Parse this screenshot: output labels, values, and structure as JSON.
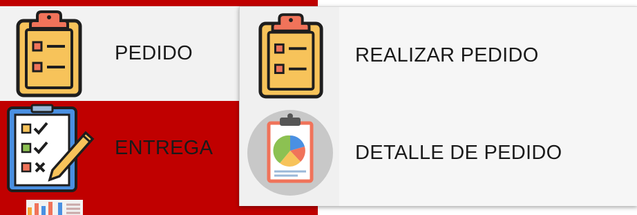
{
  "menu": {
    "items": [
      {
        "label": "PEDIDO",
        "icon": "clipboard-list-icon"
      },
      {
        "label": "ENTREGA",
        "icon": "checklist-pencil-icon"
      },
      {
        "label": "",
        "icon": "chart-report-icon"
      }
    ]
  },
  "submenu": {
    "items": [
      {
        "label": "REALIZAR PEDIDO",
        "icon": "clipboard-list-icon"
      },
      {
        "label": "DETALLE DE PEDIDO",
        "icon": "pie-chart-report-icon"
      }
    ]
  },
  "colors": {
    "menu_accent": "#c00000",
    "clipboard_body": "#f7c35a",
    "clipboard_clip": "#f0735a",
    "outline": "#1e1e1e"
  }
}
